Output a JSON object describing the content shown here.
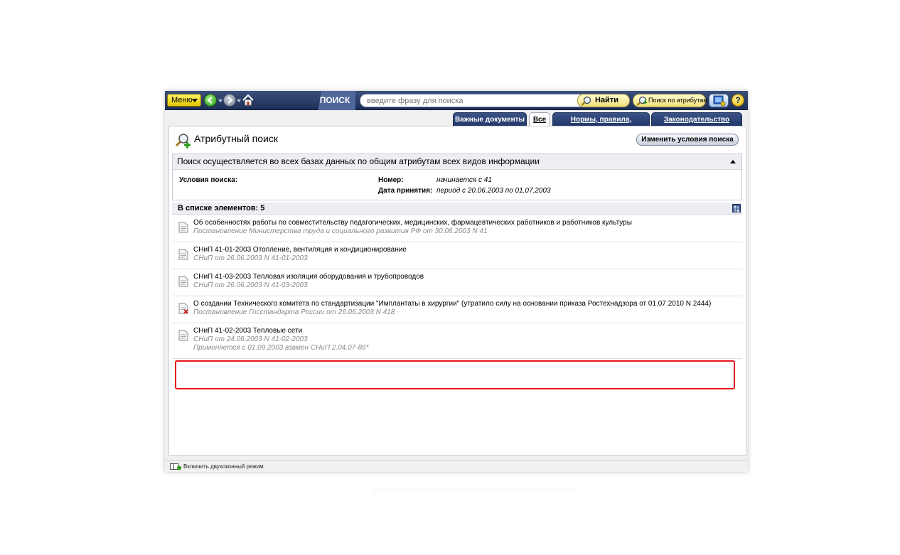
{
  "toolbar": {
    "menu_label": "Меню",
    "section_label": "ПОИСК",
    "search_placeholder": "введите фразу для поиска",
    "find_label": "Найти",
    "attr_search_label": "Поиск по атрибутам",
    "help_label": "?"
  },
  "tabs": [
    {
      "label": "Важные документы",
      "active": false
    },
    {
      "label": "Все",
      "active": true
    },
    {
      "label": "Нормы, правила, стандарты",
      "active": false
    },
    {
      "label": "Законодательство России",
      "active": false
    }
  ],
  "page": {
    "title": "Атрибутный поиск",
    "change_button": "Изменить условия поиска"
  },
  "info": {
    "header": "Поиск осуществляется во всех базах данных по общим атрибутам всех видов информации",
    "conditions_label": "Условия поиска:",
    "attributes": [
      {
        "name": "Номер:",
        "value": "начинается с 41"
      },
      {
        "name": "Дата принятия:",
        "value": "период с 20.06.2003 по 01.07.2003"
      }
    ]
  },
  "list": {
    "header": "В списке элементов: 5",
    "items": [
      {
        "title": "Об особенностях работы по совместительству педагогических, медицинских, фармацевтических работников и работников культуры",
        "subtitle": "Постановление Министерства труда и социального развития РФ от 30.06.2003 N 41",
        "extra": "",
        "revoked": false
      },
      {
        "title": "СНиП 41-01-2003 Отопление, вентиляция и кондиционирование",
        "subtitle": "СНиП от 26.06.2003 N 41-01-2003",
        "extra": "",
        "revoked": false
      },
      {
        "title": "СНиП 41-03-2003 Тепловая изоляция оборудования и трубопроводов",
        "subtitle": "СНиП от 26.06.2003 N 41-03-2003",
        "extra": "",
        "revoked": false
      },
      {
        "title": "О создании Технического комитета по стандартизации \"Имплантаты в хирургии\" (утратило силу на основании приказа Ростехнадзора от 01.07.2010 N 2444)",
        "subtitle": "Постановление Госстандарта России от 26.06.2003 N 418",
        "extra": "",
        "revoked": true
      },
      {
        "title": "СНиП 41-02-2003 Тепловые сети",
        "subtitle": "СНиП от 24.06.2003 N 41-02-2003",
        "extra": "Применяется с 01.09.2003 взамен СНиП 2.04.07-86*",
        "revoked": false
      }
    ]
  },
  "statusbar": {
    "dual_mode_label": "Включить двухоконный режим"
  },
  "colors": {
    "toolbar_bg": "#2a3d68",
    "tab_bg": "#2f4478",
    "menu_button": "#f5dc2a",
    "highlight": "#e8141b"
  }
}
